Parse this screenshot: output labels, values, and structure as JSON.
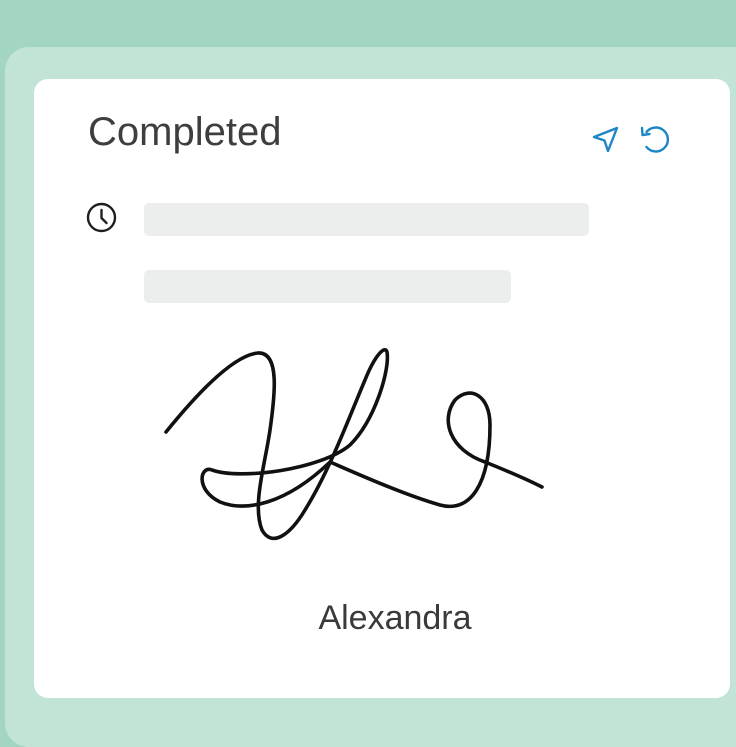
{
  "card": {
    "title": "Completed",
    "status_icon": "clock-icon",
    "actions": [
      {
        "icon": "send-icon"
      },
      {
        "icon": "undo-icon"
      }
    ]
  },
  "signature": {
    "signer_name": "Alexandra"
  },
  "colors": {
    "background": "#a2d6c3",
    "panel": "#c2e4d6",
    "card": "#ffffff",
    "accent": "#1e86c6",
    "skeleton": "#eceeee",
    "title_text": "#3e3e3e",
    "ink": "#111111"
  }
}
